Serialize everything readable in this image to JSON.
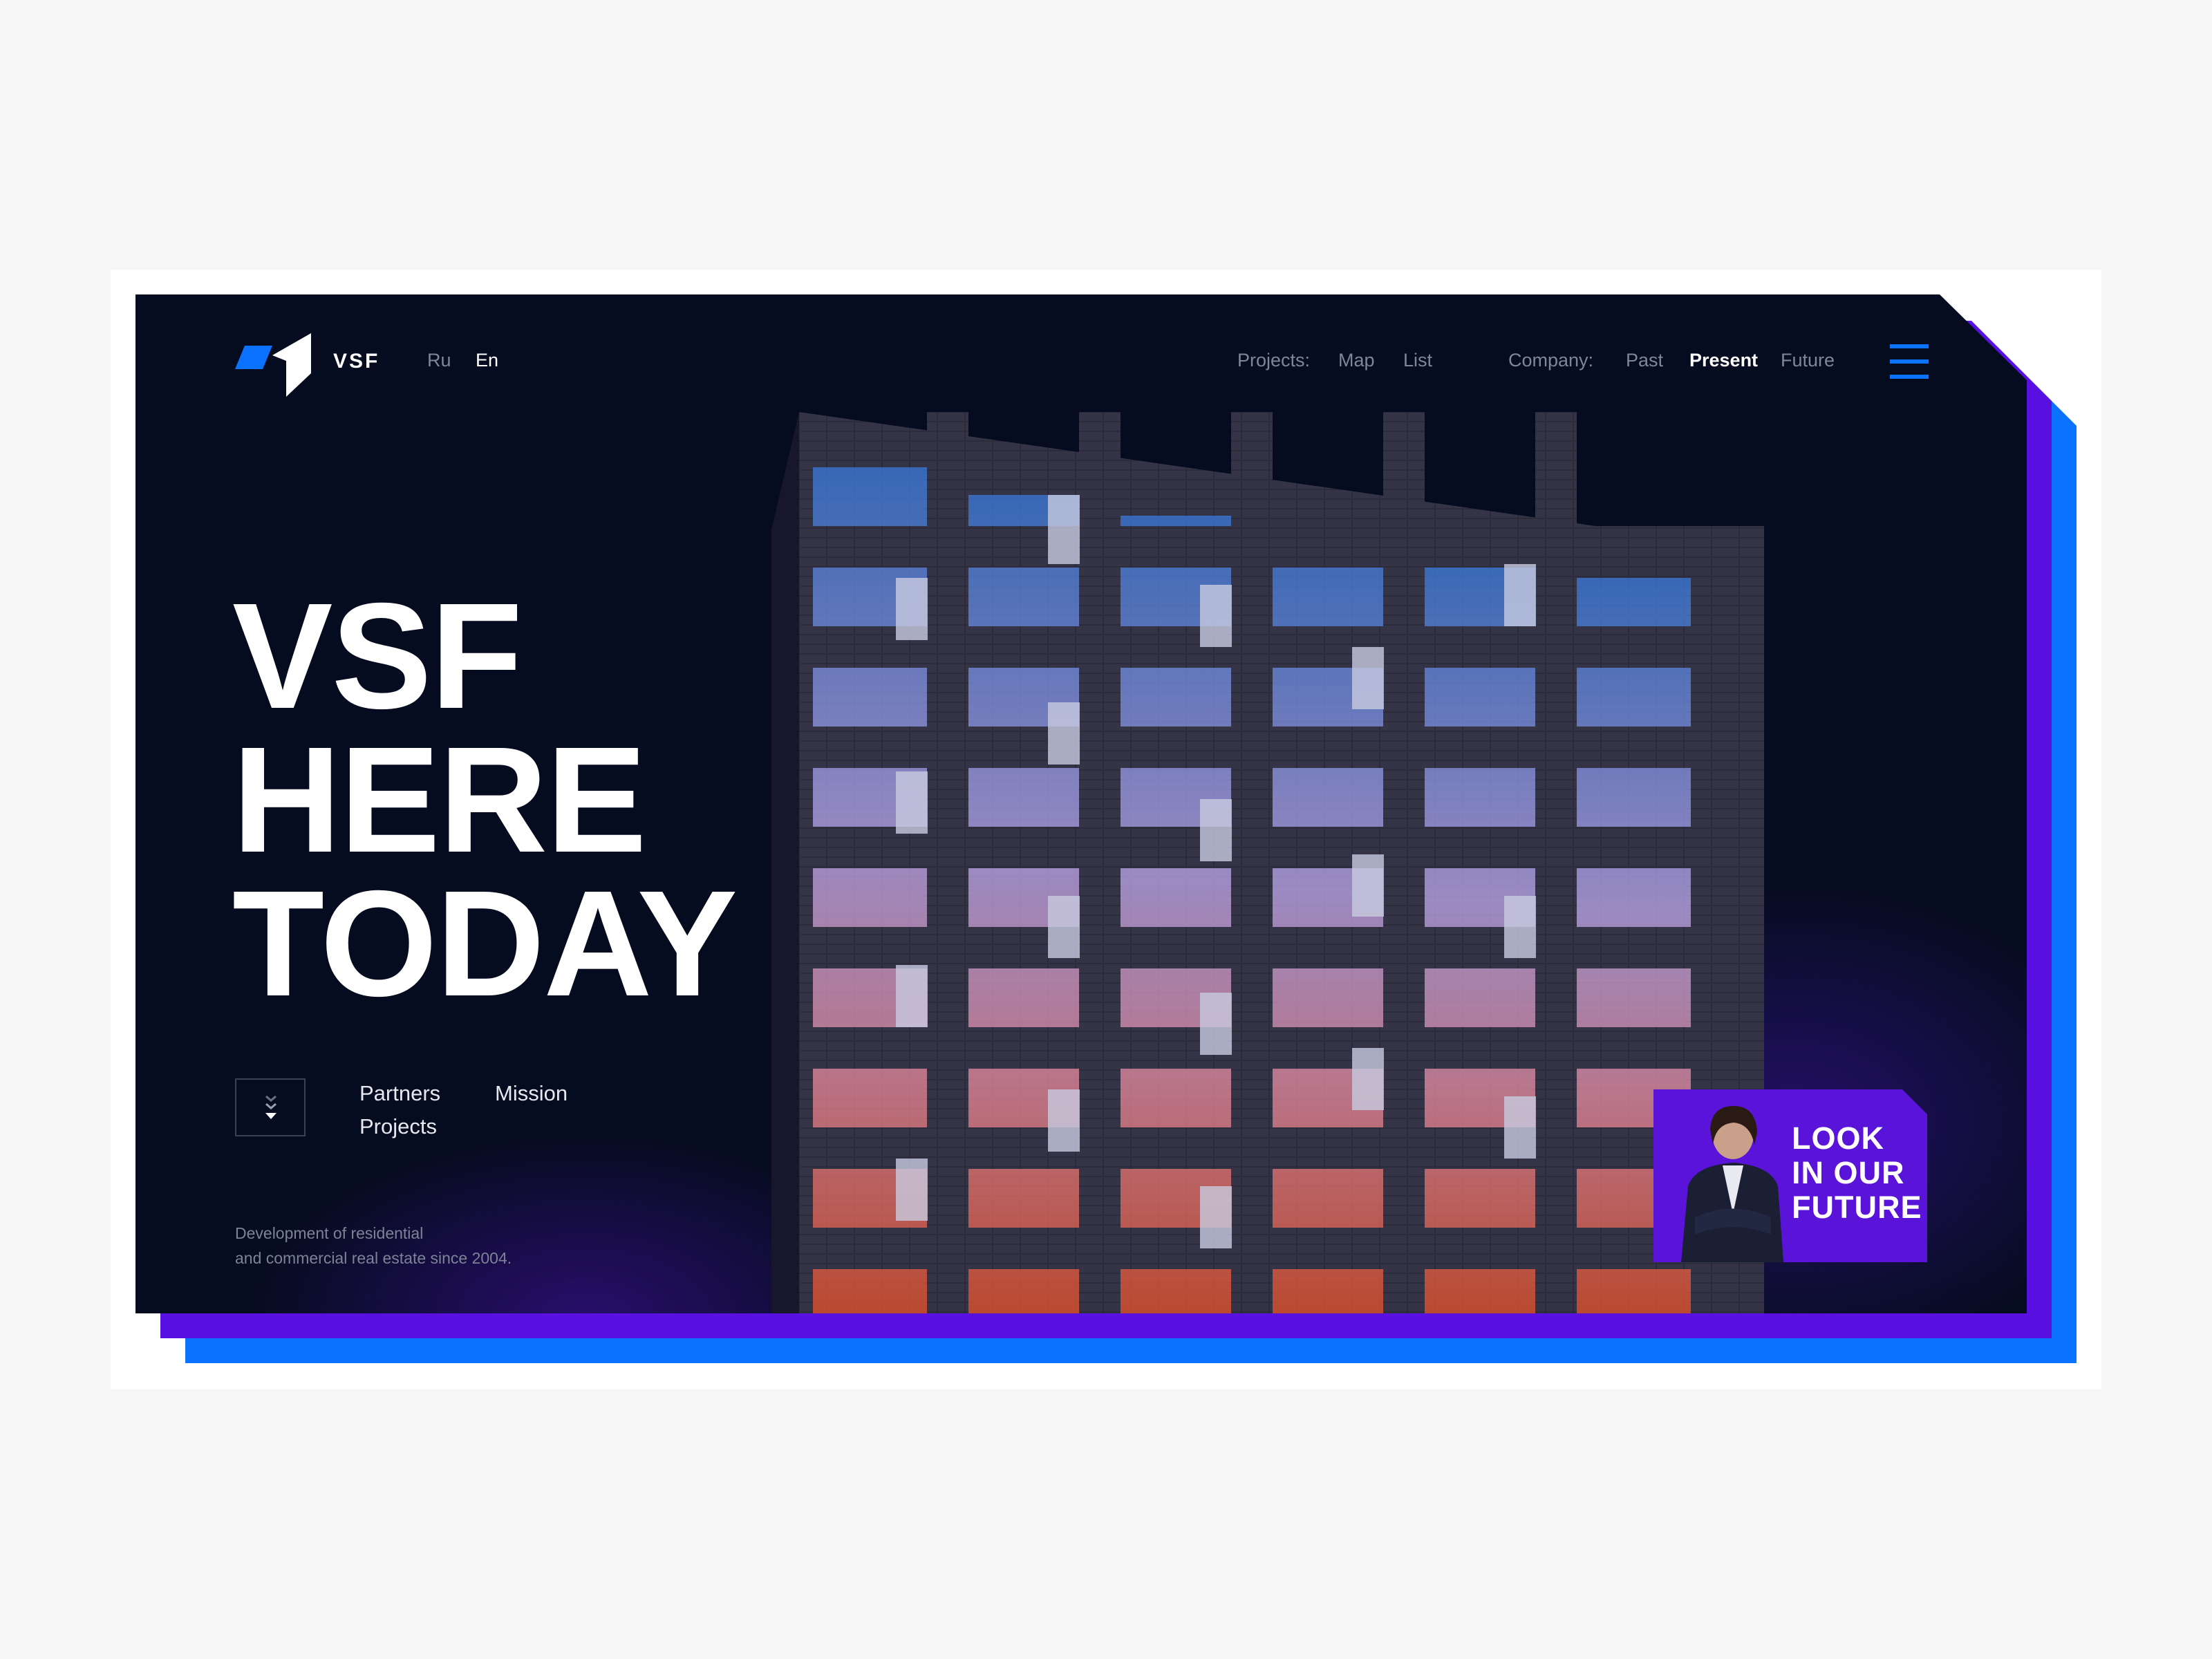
{
  "brand": {
    "name": "VSF"
  },
  "languages": [
    {
      "label": "Ru"
    },
    {
      "label": "En"
    }
  ],
  "nav": {
    "projects_label": "Projects:",
    "projects": [
      {
        "label": "Map"
      },
      {
        "label": "List"
      }
    ],
    "company_label": "Company:",
    "company": [
      {
        "label": "Past"
      },
      {
        "label": "Present"
      },
      {
        "label": "Future"
      }
    ]
  },
  "hero": {
    "headline": [
      "VSF",
      "HERE",
      "TODAY"
    ],
    "links": [
      {
        "label": "Partners"
      },
      {
        "label": "Mission"
      },
      {
        "label": "Projects"
      }
    ],
    "description": [
      "Development of residential",
      "and commercial real estate since 2004."
    ]
  },
  "promo": {
    "lines": [
      "LOOK",
      "IN OUR",
      "FUTURE"
    ]
  },
  "colors": {
    "background": "#060c1f",
    "accent_blue": "#0a72ff",
    "accent_purple": "#5811e0",
    "text_muted": "#7f8699"
  },
  "icons": {
    "logo": "vsf-logo-icon",
    "menu": "hamburger-menu-icon",
    "scroll": "scroll-down-icon"
  }
}
